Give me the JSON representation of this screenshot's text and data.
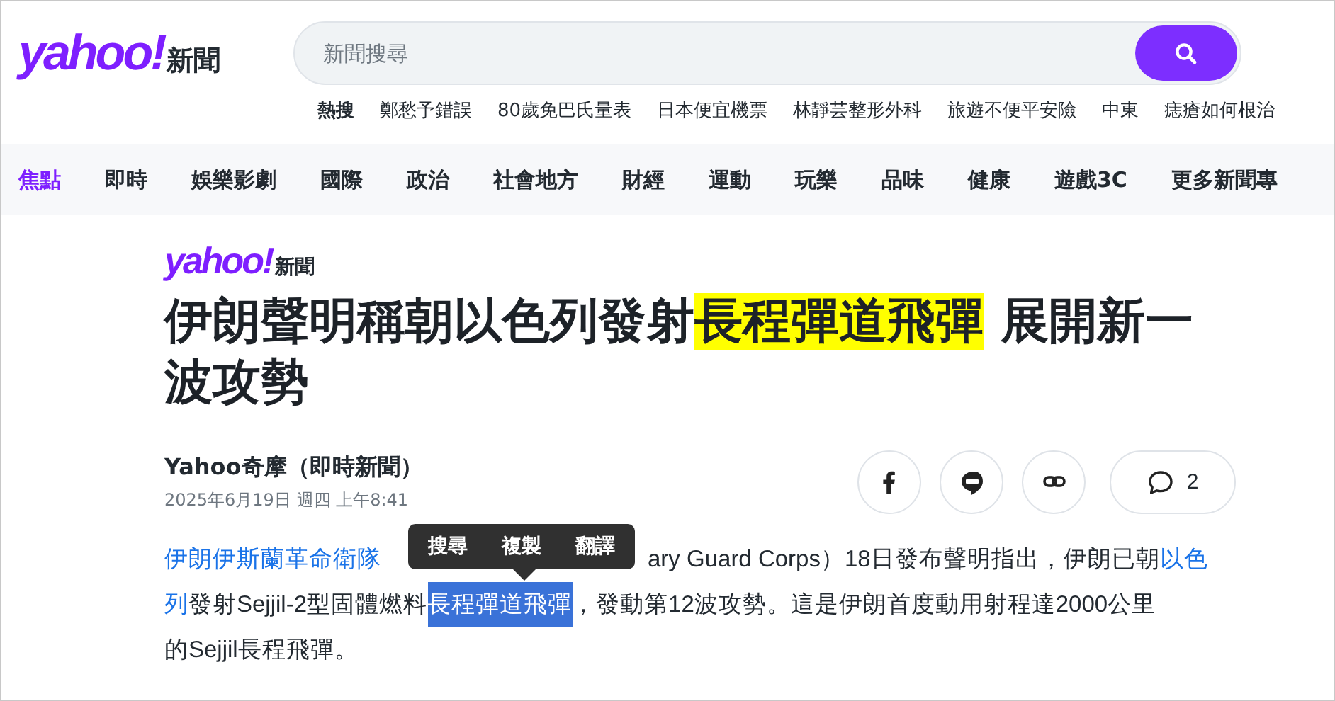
{
  "header": {
    "logo": {
      "brand": "yahoo!",
      "section": "新聞"
    },
    "search": {
      "placeholder": "新聞搜尋"
    },
    "hot_label": "熱搜",
    "hot_searches": [
      "鄭愁予錯誤",
      "80歲免巴氏量表",
      "日本便宜機票",
      "林靜芸整形外科",
      "旅遊不便平安險",
      "中東",
      "痣瘡如何根治"
    ]
  },
  "nav": [
    {
      "label": "焦點",
      "selected": true
    },
    {
      "label": "即時",
      "selected": false
    },
    {
      "label": "娛樂影劇",
      "selected": false
    },
    {
      "label": "國際",
      "selected": false
    },
    {
      "label": "政治",
      "selected": false
    },
    {
      "label": "社會地方",
      "selected": false
    },
    {
      "label": "財經",
      "selected": false
    },
    {
      "label": "運動",
      "selected": false
    },
    {
      "label": "玩樂",
      "selected": false
    },
    {
      "label": "品味",
      "selected": false
    },
    {
      "label": "健康",
      "selected": false
    },
    {
      "label": "遊戲3C",
      "selected": false
    },
    {
      "label": "更多新聞專",
      "selected": false
    }
  ],
  "article": {
    "source_logo": {
      "brand": "yahoo!",
      "section": "新聞"
    },
    "headline": [
      {
        "text": "伊朗聲明稱朝以色列發射",
        "highlighted": false
      },
      {
        "text": "長程彈道飛彈",
        "highlighted": true
      },
      {
        "text": " 展開新一波攻勢",
        "highlighted": false
      }
    ],
    "author": "Yahoo奇摩（即時新聞）",
    "date": "2025年6月19日 週四 上午8:41",
    "share": [
      {
        "kind": "facebook"
      },
      {
        "kind": "line"
      },
      {
        "kind": "link"
      }
    ],
    "comments": "2",
    "body_lines": [
      [
        {
          "kind": "link",
          "text": "伊朗伊斯蘭革命衛隊"
        },
        {
          "kind": "hidden"
        },
        {
          "kind": "text",
          "text": "ary Guard Corps）18日發布聲明指出，伊朗已朝"
        },
        {
          "kind": "link",
          "text": "以色"
        }
      ],
      [
        {
          "kind": "link",
          "text": "列"
        },
        {
          "kind": "text",
          "text": "發射Sejjil-2型固體燃料"
        },
        {
          "kind": "selected",
          "text": "長程彈道飛彈"
        },
        {
          "kind": "text",
          "text": "，發動第12波攻勢。這是伊朗首度動用射程達2000公里"
        }
      ],
      [
        {
          "kind": "text",
          "text": "的Sejjil長程飛彈。"
        }
      ]
    ],
    "popup": [
      "搜尋",
      "複製",
      "翻譯"
    ]
  }
}
